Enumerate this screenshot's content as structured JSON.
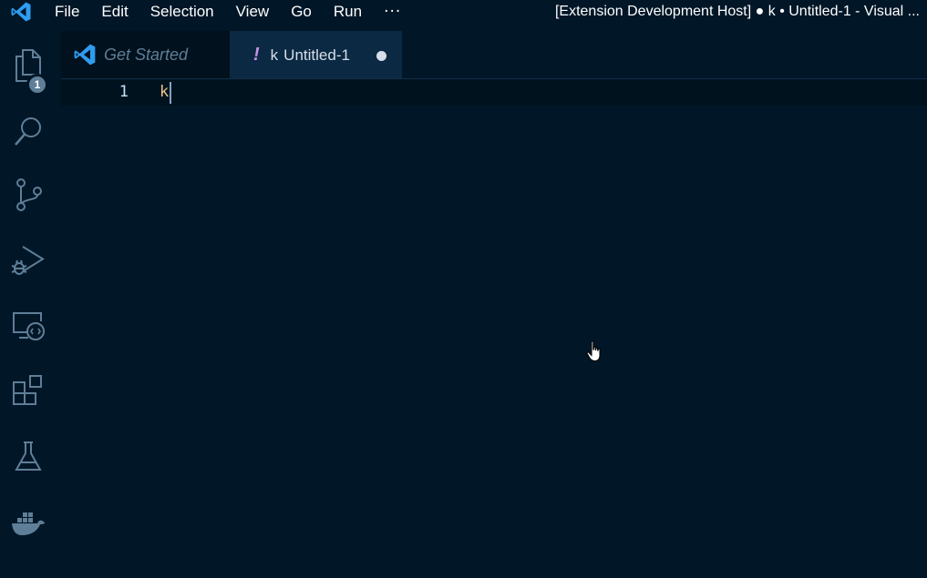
{
  "titlebar": {
    "menu": [
      "File",
      "Edit",
      "Selection",
      "View",
      "Go",
      "Run"
    ],
    "more": "···",
    "window_title": "[Extension Development Host] ● k • Untitled-1 - Visual ..."
  },
  "activitybar": {
    "items": [
      {
        "icon": "files-icon",
        "badge": "1"
      },
      {
        "icon": "search-icon"
      },
      {
        "icon": "source-control-icon"
      },
      {
        "icon": "run-debug-icon"
      },
      {
        "icon": "remote-explorer-icon"
      },
      {
        "icon": "extensions-icon"
      },
      {
        "icon": "testing-flask-icon"
      },
      {
        "icon": "docker-icon"
      }
    ]
  },
  "tabs": [
    {
      "label": "Get Started",
      "icon": "vscode-logo-icon",
      "active": false
    },
    {
      "prefix": "!",
      "name": "k",
      "label": "Untitled-1",
      "dirty": true,
      "active": true
    }
  ],
  "editor": {
    "line_numbers": [
      "1"
    ],
    "lines": [
      "k"
    ]
  },
  "colors": {
    "background": "#011627",
    "accent": "#c792ea",
    "foreground": "#d6deeb",
    "code_text": "#ecc48d"
  }
}
